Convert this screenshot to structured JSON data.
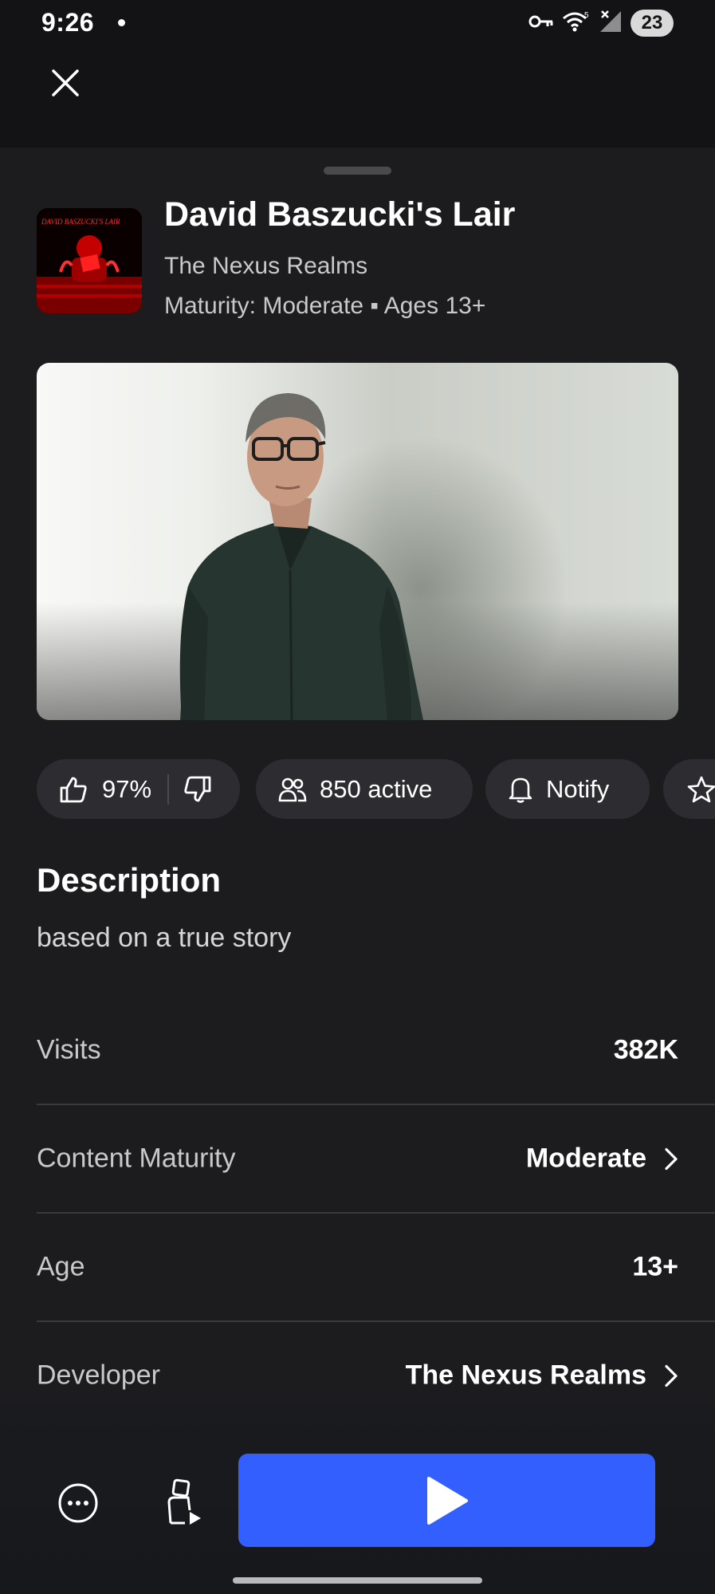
{
  "status_bar": {
    "time": "9:26",
    "battery": "23",
    "icons": [
      "vpn-key-icon",
      "wifi-icon",
      "signal-icon",
      "battery-icon"
    ]
  },
  "game": {
    "title": "David Baszucki's Lair",
    "creator": "The Nexus Realms",
    "maturity_line": "Maturity: Moderate ▪ Ages 13+",
    "thumb_text": "DAVID BASZUCKI'S LAIR"
  },
  "stats": {
    "rating": "97%",
    "active": "850 active",
    "notify": "Notify"
  },
  "description": {
    "heading": "Description",
    "text": "based on a true story"
  },
  "info": [
    {
      "label": "Visits",
      "value": "382K",
      "has_chevron": false
    },
    {
      "label": "Content Maturity",
      "value": "Moderate",
      "has_chevron": true
    },
    {
      "label": "Age",
      "value": "13+",
      "has_chevron": false
    },
    {
      "label": "Developer",
      "value": "The Nexus Realms",
      "has_chevron": true
    }
  ],
  "colors": {
    "background": "#1c1c1e",
    "play_button": "#335fff",
    "pill": "#2d2d31"
  }
}
